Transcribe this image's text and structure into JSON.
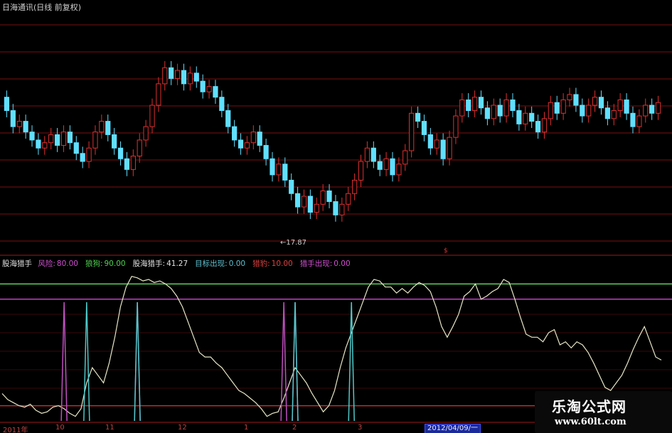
{
  "header": {
    "title": "日海通讯(日线 前复权)",
    "low_marker": "←17.87",
    "mid_marker": "$"
  },
  "indicator": {
    "name": "股海猎手",
    "items": [
      {
        "label": "风险:",
        "value": "80.00",
        "color": "#d050d0"
      },
      {
        "label": "狼狗:",
        "value": "90.00",
        "color": "#50d050"
      },
      {
        "label": "股海猎手:",
        "value": "41.27",
        "color": "#e0e0e0"
      },
      {
        "label": "目标出现:",
        "value": "0.00",
        "color": "#60c0d0"
      },
      {
        "label": "猎豹:",
        "value": "10.00",
        "color": "#e04040"
      },
      {
        "label": "猎手出现:",
        "value": "0.00",
        "color": "#d050d0"
      }
    ]
  },
  "x_axis": {
    "ticks": [
      "2011年",
      "10",
      "11",
      "12",
      "1",
      "2",
      "3",
      "2012/04/09/一"
    ]
  },
  "watermark": {
    "title": "乐淘公式网",
    "url": "www.60lt.com"
  },
  "colors": {
    "up": "#e03030",
    "down": "#60e0ff",
    "grid": "#7a1010",
    "oscillator": "#e8e8c8",
    "line_high": "#60d060",
    "line_mid": "#c040c0",
    "line_low": "#c03030",
    "spike_magenta": "#c050c0",
    "spike_cyan": "#50c8c8"
  },
  "chart_data": {
    "type": "candlestick",
    "title": "日海通讯(日线 前复权)",
    "price_low_label": 17.87,
    "levels": {
      "风险": 80.0,
      "狼狗": 90.0,
      "猎豹": 10.0
    },
    "oscillator": {
      "name": "股海猎手",
      "current": 41.27,
      "values": [
        18,
        14,
        12,
        10,
        9,
        11,
        7,
        5,
        6,
        9,
        10,
        8,
        5,
        3,
        8,
        25,
        35,
        30,
        25,
        38,
        55,
        75,
        88,
        95,
        94,
        92,
        93,
        91,
        92,
        90,
        87,
        82,
        75,
        65,
        55,
        45,
        42,
        42,
        38,
        35,
        30,
        25,
        20,
        18,
        15,
        12,
        8,
        3,
        5,
        6,
        15,
        25,
        35,
        30,
        25,
        18,
        12,
        6,
        10,
        20,
        35,
        48,
        58,
        68,
        78,
        88,
        93,
        92,
        88,
        88,
        84,
        87,
        84,
        88,
        91,
        89,
        85,
        75,
        62,
        55,
        62,
        70,
        82,
        85,
        90,
        80,
        82,
        85,
        87,
        93,
        91,
        80,
        68,
        57,
        55,
        55,
        52,
        58,
        60,
        50,
        52,
        48,
        52,
        50,
        45,
        38,
        30,
        22,
        20,
        25,
        30,
        38,
        47,
        55,
        62,
        52,
        42,
        40
      ]
    },
    "spikes": {
      "magenta": [
        11,
        24,
        50,
        52
      ],
      "cyan": [
        15,
        24,
        52,
        62
      ]
    },
    "candles": [
      {
        "o": 22.9,
        "c": 22.4
      },
      {
        "o": 22.4,
        "c": 21.8
      },
      {
        "o": 21.8,
        "c": 22.0
      },
      {
        "o": 22.0,
        "c": 21.6
      },
      {
        "o": 21.6,
        "c": 21.3
      },
      {
        "o": 21.3,
        "c": 21.0
      },
      {
        "o": 21.0,
        "c": 21.2
      },
      {
        "o": 21.2,
        "c": 21.5
      },
      {
        "o": 21.5,
        "c": 21.1
      },
      {
        "o": 21.1,
        "c": 21.6
      },
      {
        "o": 21.6,
        "c": 21.2
      },
      {
        "o": 21.2,
        "c": 20.8
      },
      {
        "o": 20.8,
        "c": 20.5
      },
      {
        "o": 20.5,
        "c": 21.0
      },
      {
        "o": 21.0,
        "c": 21.6
      },
      {
        "o": 21.6,
        "c": 22.0
      },
      {
        "o": 22.0,
        "c": 21.5
      },
      {
        "o": 21.5,
        "c": 21.0
      },
      {
        "o": 21.0,
        "c": 20.6
      },
      {
        "o": 20.6,
        "c": 20.2
      },
      {
        "o": 20.2,
        "c": 20.7
      },
      {
        "o": 20.7,
        "c": 21.3
      },
      {
        "o": 21.3,
        "c": 21.8
      },
      {
        "o": 21.8,
        "c": 22.6
      },
      {
        "o": 22.6,
        "c": 23.4
      },
      {
        "o": 23.4,
        "c": 24.0
      },
      {
        "o": 24.0,
        "c": 23.6
      },
      {
        "o": 23.6,
        "c": 23.9
      },
      {
        "o": 23.9,
        "c": 23.4
      },
      {
        "o": 23.4,
        "c": 23.8
      },
      {
        "o": 23.8,
        "c": 23.5
      },
      {
        "o": 23.5,
        "c": 23.1
      },
      {
        "o": 23.1,
        "c": 23.3
      },
      {
        "o": 23.3,
        "c": 22.9
      },
      {
        "o": 22.9,
        "c": 22.4
      },
      {
        "o": 22.4,
        "c": 21.8
      },
      {
        "o": 21.8,
        "c": 21.3
      },
      {
        "o": 21.3,
        "c": 21.0
      },
      {
        "o": 21.0,
        "c": 21.2
      },
      {
        "o": 21.2,
        "c": 21.6
      },
      {
        "o": 21.6,
        "c": 21.1
      },
      {
        "o": 21.1,
        "c": 20.6
      },
      {
        "o": 20.6,
        "c": 20.0
      },
      {
        "o": 20.0,
        "c": 20.4
      },
      {
        "o": 20.4,
        "c": 19.8
      },
      {
        "o": 19.8,
        "c": 19.3
      },
      {
        "o": 19.3,
        "c": 18.8
      },
      {
        "o": 18.8,
        "c": 19.2
      },
      {
        "o": 19.2,
        "c": 18.6
      },
      {
        "o": 18.6,
        "c": 18.9
      },
      {
        "o": 18.9,
        "c": 19.4
      },
      {
        "o": 19.4,
        "c": 19.0
      },
      {
        "o": 19.0,
        "c": 18.5
      },
      {
        "o": 18.5,
        "c": 18.9
      },
      {
        "o": 18.9,
        "c": 19.3
      },
      {
        "o": 19.3,
        "c": 19.8
      },
      {
        "o": 19.8,
        "c": 20.5
      },
      {
        "o": 20.5,
        "c": 21.0
      },
      {
        "o": 21.0,
        "c": 20.5
      },
      {
        "o": 20.5,
        "c": 20.2
      },
      {
        "o": 20.2,
        "c": 20.6
      },
      {
        "o": 20.6,
        "c": 20.0
      },
      {
        "o": 20.0,
        "c": 20.4
      },
      {
        "o": 20.4,
        "c": 20.9
      },
      {
        "o": 20.9,
        "c": 22.3
      },
      {
        "o": 22.3,
        "c": 22.0
      },
      {
        "o": 22.0,
        "c": 21.5
      },
      {
        "o": 21.5,
        "c": 21.0
      },
      {
        "o": 21.0,
        "c": 21.3
      },
      {
        "o": 21.3,
        "c": 20.6
      },
      {
        "o": 20.6,
        "c": 21.4
      },
      {
        "o": 21.4,
        "c": 22.2
      },
      {
        "o": 22.2,
        "c": 22.8
      },
      {
        "o": 22.8,
        "c": 22.4
      },
      {
        "o": 22.4,
        "c": 22.9
      },
      {
        "o": 22.9,
        "c": 22.5
      },
      {
        "o": 22.5,
        "c": 22.1
      },
      {
        "o": 22.1,
        "c": 22.6
      },
      {
        "o": 22.6,
        "c": 22.2
      },
      {
        "o": 22.2,
        "c": 22.8
      },
      {
        "o": 22.8,
        "c": 22.4
      },
      {
        "o": 22.4,
        "c": 21.9
      },
      {
        "o": 21.9,
        "c": 22.3
      },
      {
        "o": 22.3,
        "c": 22.0
      },
      {
        "o": 22.0,
        "c": 21.6
      },
      {
        "o": 21.6,
        "c": 22.1
      },
      {
        "o": 22.1,
        "c": 22.7
      },
      {
        "o": 22.7,
        "c": 22.3
      },
      {
        "o": 22.3,
        "c": 22.8
      },
      {
        "o": 22.8,
        "c": 23.0
      },
      {
        "o": 23.0,
        "c": 22.6
      },
      {
        "o": 22.6,
        "c": 22.2
      },
      {
        "o": 22.2,
        "c": 22.6
      },
      {
        "o": 22.6,
        "c": 22.9
      },
      {
        "o": 22.9,
        "c": 22.5
      },
      {
        "o": 22.5,
        "c": 22.1
      },
      {
        "o": 22.1,
        "c": 22.4
      },
      {
        "o": 22.4,
        "c": 22.8
      },
      {
        "o": 22.8,
        "c": 22.3
      },
      {
        "o": 22.3,
        "c": 21.8
      },
      {
        "o": 21.8,
        "c": 22.2
      },
      {
        "o": 22.2,
        "c": 22.6
      },
      {
        "o": 22.6,
        "c": 22.3
      },
      {
        "o": 22.3,
        "c": 22.7
      }
    ]
  }
}
